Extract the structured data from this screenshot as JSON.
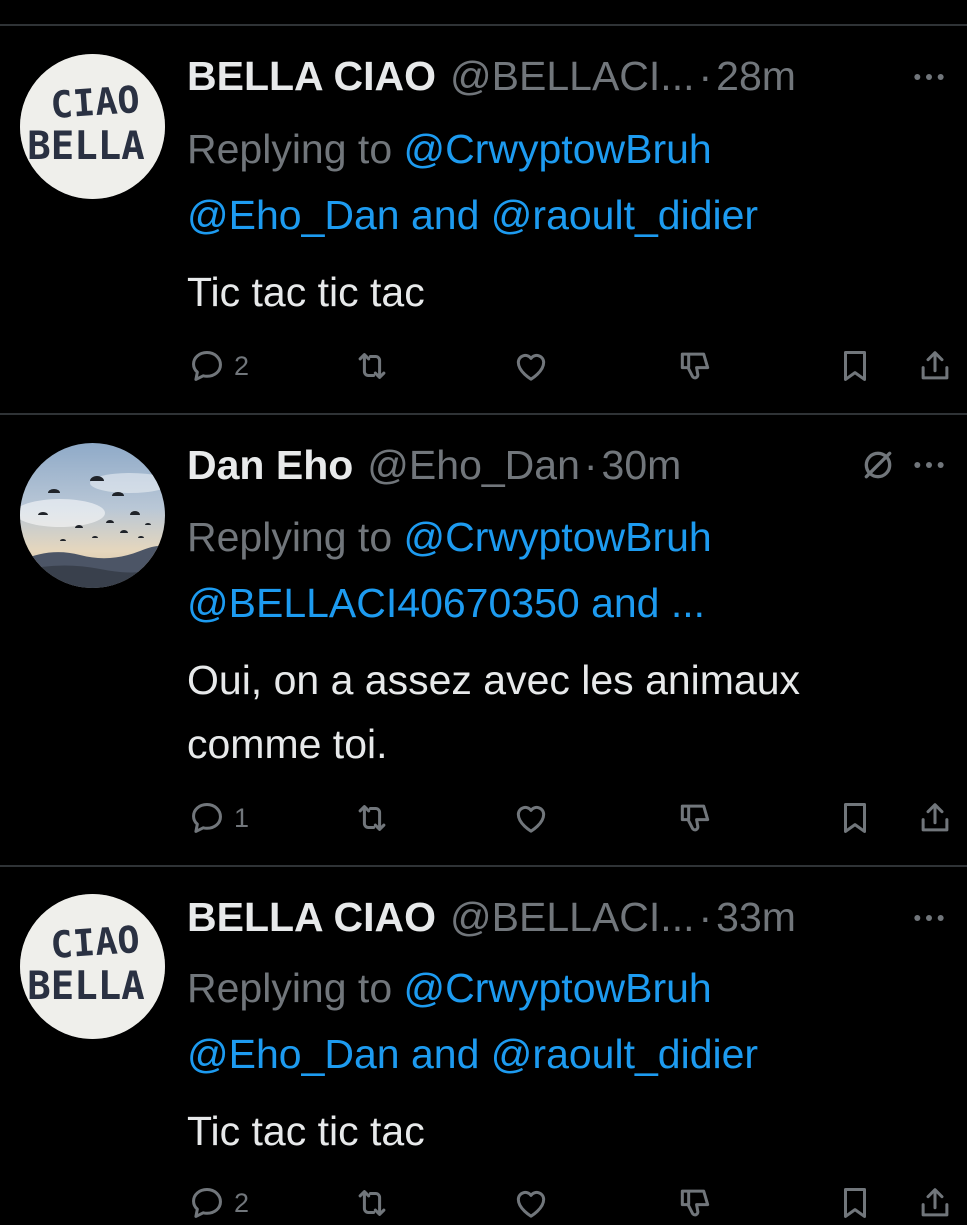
{
  "tweets": [
    {
      "display_name": "BELLA CIAO",
      "handle": "@BELLACI...",
      "separator": "·",
      "time": "28m",
      "avatar_text_1": "CIAO",
      "avatar_text_2": "BELLA",
      "reply_prefix": "Replying to ",
      "reply_line_1_link": "@CrwyptowBruh",
      "reply_line_2_link_a": "@Eho_Dan",
      "reply_line_2_joiner": " and ",
      "reply_line_2_link_b": "@raoult_didier",
      "text_lines": [
        "Tic tac tic tac"
      ],
      "reply_count": "2"
    },
    {
      "display_name": "Dan Eho",
      "handle": "@Eho_Dan",
      "separator": "·",
      "time": "30m",
      "reply_prefix": "Replying to ",
      "reply_line_1_link": "@CrwyptowBruh",
      "reply_line_2_link_a": "@BELLACI40670350 and ...",
      "text_lines": [
        "Oui, on a assez avec les animaux",
        "comme toi."
      ],
      "reply_count": "1"
    },
    {
      "display_name": "BELLA CIAO",
      "handle": "@BELLACI...",
      "separator": "·",
      "time": "33m",
      "avatar_text_1": "CIAO",
      "avatar_text_2": "BELLA",
      "reply_prefix": "Replying to ",
      "reply_line_1_link": "@CrwyptowBruh",
      "reply_line_2_link_a": "@Eho_Dan",
      "reply_line_2_joiner": " and ",
      "reply_line_2_link_b": "@raoult_didier",
      "text_lines": [
        "Tic tac tic tac"
      ],
      "reply_count": "2"
    }
  ],
  "icons": {
    "reply": "speech-bubble-icon",
    "retweet": "retweet-icon",
    "like": "heart-icon",
    "dislike": "thumbs-down-icon",
    "bookmark": "bookmark-icon",
    "share": "share-icon",
    "more": "ellipsis-icon",
    "mute": "mute-icon"
  },
  "colors": {
    "background": "#000000",
    "text": "#e7e9ea",
    "muted": "#71767b",
    "link": "#1d9bf0",
    "divider": "#2f3336"
  }
}
